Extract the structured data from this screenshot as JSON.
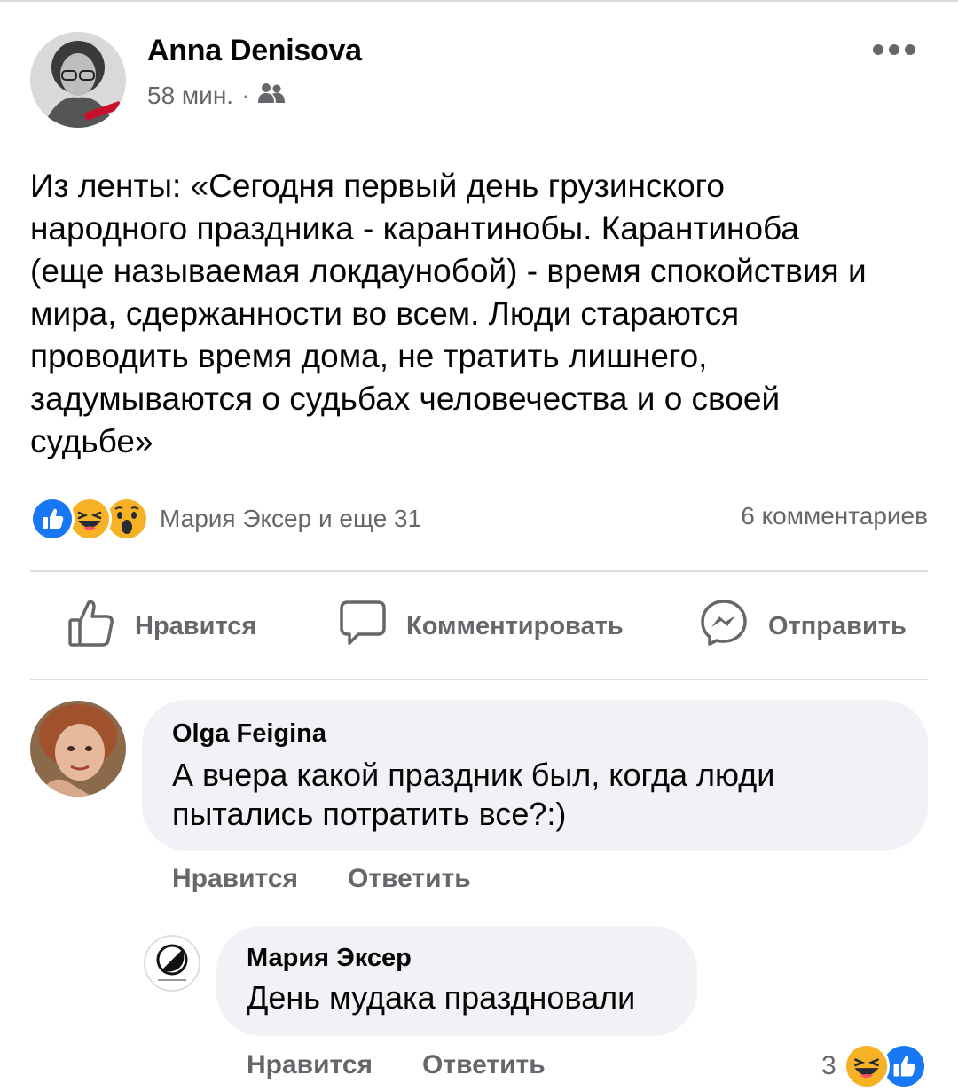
{
  "post": {
    "author": "Anna Denisova",
    "time": "58 мин.",
    "separator": "·",
    "audience_icon": "friends-icon",
    "text": "Из ленты: «Сегодня первый день грузинского\nнародного праздника  - карантинобы. Карантиноба\n(еще называемая локдаунобой) - время спокойствия и\nмира, сдержанности во всем. Люди стараются\nпроводить время дома, не тратить лишнего,\nзадумываются о судьбах человечества и о своей\nсудьбе»"
  },
  "reactions": {
    "icons": [
      "like-icon",
      "haha-icon",
      "wow-icon"
    ],
    "names": "Мария Эксер и еще 31",
    "comments": "6 комментариев"
  },
  "actions": {
    "like": "Нравится",
    "comment": "Комментировать",
    "send": "Отправить"
  },
  "comments": [
    {
      "author": "Olga Feigina",
      "text": "А вчера какой праздник был,  когда люди\nпытались потратить все?:)",
      "like": "Нравится",
      "reply": "Ответить"
    },
    {
      "author": "Мария Эксер",
      "text": "День мудака праздновали",
      "like": "Нравится",
      "reply": "Ответить",
      "reaction_count": "3",
      "reaction_icons": [
        "haha-icon",
        "like-icon"
      ]
    }
  ],
  "colors": {
    "like_blue": "#1877f2",
    "secondary_text": "#65676b",
    "bubble_bg": "#f0f2f5",
    "emoji_yellow": "#f7b125"
  }
}
